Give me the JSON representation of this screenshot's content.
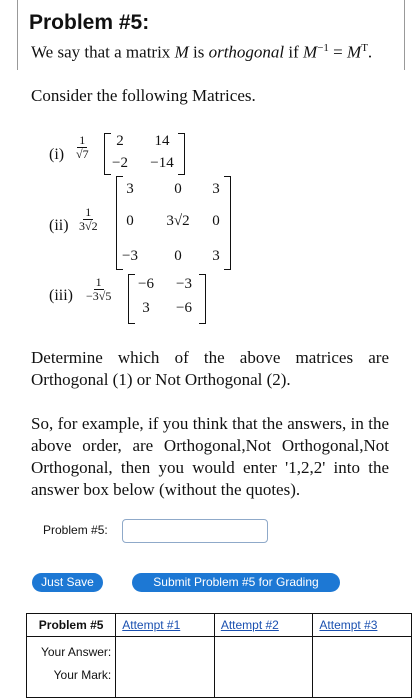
{
  "problem": {
    "title": "Problem #5:",
    "intro_prefix": "We say that a matrix ",
    "intro_M": "M",
    "intro_is": " is ",
    "intro_term": "orthogonal",
    "intro_if": " if ",
    "intro_Minv": "M",
    "intro_inv_exp": "−1",
    "intro_eq": " = ",
    "intro_MT": "M",
    "intro_T_exp": "T",
    "intro_period": ".",
    "consider": "Consider the following Matrices."
  },
  "matrices": [
    {
      "label": "(i)",
      "factor_num": "1",
      "factor_den": "√7",
      "rows": [
        [
          "2",
          "14"
        ],
        [
          "−2",
          "−14"
        ]
      ]
    },
    {
      "label": "(ii)",
      "factor_num": "1",
      "factor_den": "3√2",
      "rows": [
        [
          "3",
          "0",
          "3"
        ],
        [
          "0",
          "3√2",
          "0"
        ],
        [
          "−3",
          "0",
          "3"
        ]
      ]
    },
    {
      "label": "(iii)",
      "factor_num": "1",
      "factor_den": "−3√5",
      "rows": [
        [
          "−6",
          "−3"
        ],
        [
          "3",
          "−6"
        ]
      ]
    }
  ],
  "instructions": {
    "determine": "Determine which of the above matrices are Orthogonal (1) or Not Orthogonal (2).",
    "example": "So, for example, if you think that the answers, in the above order, are Orthogonal,Not Orthogonal,Not Orthogonal, then you would enter '1,2,2' into the answer box below (without the quotes)."
  },
  "answer": {
    "label": "Problem #5:",
    "value": ""
  },
  "buttons": {
    "save": "Just Save",
    "submit": "Submit Problem #5 for Grading"
  },
  "attempts_table": {
    "row_header": "Problem #5",
    "columns": [
      "Attempt #1",
      "Attempt #2",
      "Attempt #3"
    ],
    "your_answer": "Your Answer:",
    "your_mark": "Your Mark:"
  },
  "colors": {
    "button": "#1d78d4",
    "link": "#1a50b0",
    "input_border": "#8fa9c9"
  }
}
